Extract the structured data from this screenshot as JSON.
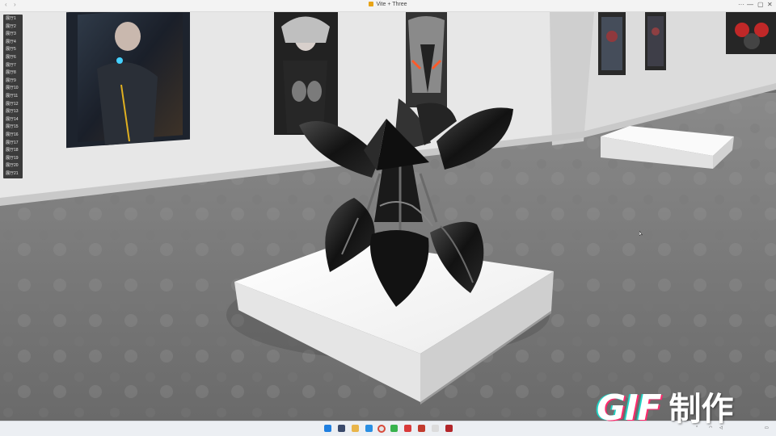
{
  "window": {
    "title": "Vite + Three",
    "nav_back": "‹",
    "nav_forward": "›",
    "more": "···",
    "minimize": "—",
    "maximize": "▢",
    "close": "✕"
  },
  "menu": {
    "items": [
      "展厅1",
      "展厅2",
      "展厅3",
      "展厅4",
      "展厅5",
      "展厅6",
      "展厅7",
      "展厅8",
      "展厅9",
      "展厅10",
      "展厅11",
      "展厅12",
      "展厅13",
      "展厅14",
      "展厅15",
      "展厅16",
      "展厅17",
      "展厅18",
      "展厅19",
      "展厅20",
      "展厅21"
    ]
  },
  "scene": {
    "icons": [
      "gallery-wall",
      "portrait-poster",
      "pedestal",
      "sculpture-flower"
    ]
  },
  "watermark": {
    "gif": "GIF",
    "text": "制作"
  },
  "taskbar": {
    "icons": [
      "windows-start-icon",
      "file-explorer-icon",
      "folder-icon",
      "vscode-icon",
      "chrome-icon",
      "wechat-icon",
      "wps-icon",
      "wps-writer-icon",
      "app-icon-1",
      "app-icon-2"
    ],
    "tray_time": "",
    "tray_date": ""
  },
  "colors": {
    "wall": "#e6e6e6",
    "floor": "#7a7a7a",
    "pedestal": "#f7f7f7",
    "sculpture": "#151515",
    "menu_bg": "#3b3b3b"
  }
}
